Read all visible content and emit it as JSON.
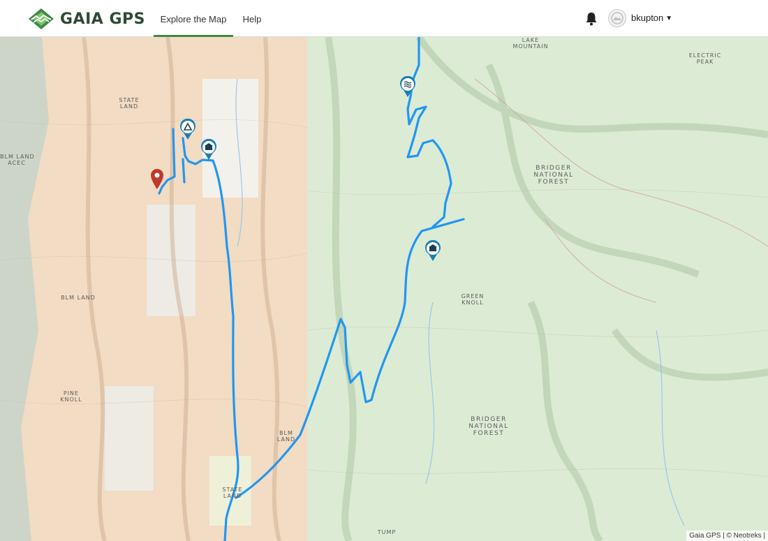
{
  "header": {
    "logo_text": "GAIA GPS",
    "nav": {
      "explore": "Explore the Map",
      "help": "Help"
    },
    "username": "bkupton"
  },
  "map": {
    "labels": {
      "lake_mountain": "LAKE\nMOUNTAIN",
      "electric_peak": "ELECTRIC\nPEAK",
      "state_land_1": "STATE\nLAND",
      "blm_acec": "BLM LAND\nACEC",
      "bridger_nf_1": "BRIDGER\nNATIONAL\nFOREST",
      "blm_land_1": "BLM LAND",
      "green_knoll": "GREEN\nKNOLL",
      "pine_knoll": "PINE\nKNOLL",
      "bridger_nf_2": "BRIDGER\nNATIONAL\nFOREST",
      "blm_land_2": "BLM\nLAND",
      "state_land_2": "STATE\nLAND",
      "tump": "TUMP"
    },
    "attribution": "Gaia GPS | © Neotreks |",
    "colors": {
      "blm": "#f2dcc3",
      "forest": "#dcebd4",
      "track": "#2196f3",
      "marker": "#c0392b",
      "poi": "#1a7fb5",
      "brand": "#3c8a46"
    }
  },
  "icons": {
    "logo": "gaia-mountain-logo",
    "bell": "bell-icon",
    "avatar": "avatar-icon",
    "chevron": "chevron-down-icon",
    "camp": "campsite-icon",
    "cabin": "cabin-icon",
    "water": "water-icon",
    "pin": "location-pin-icon"
  }
}
